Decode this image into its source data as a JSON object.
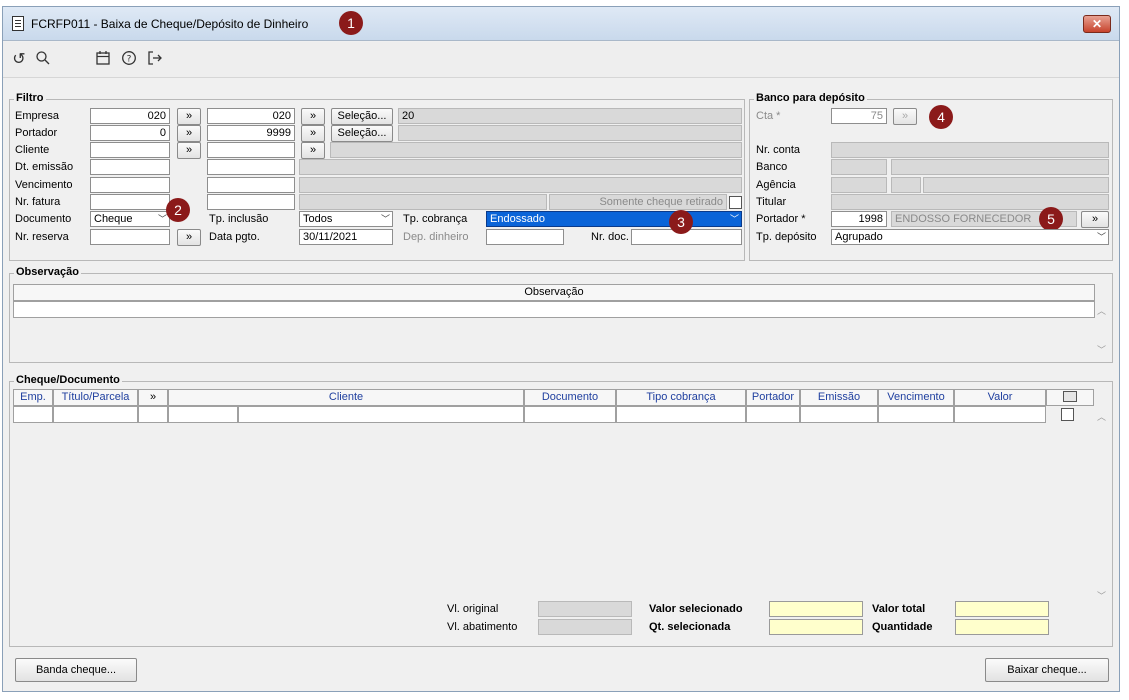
{
  "window": {
    "title": "FCRFP011 - Baixa de Cheque/Depósito de Dinheiro",
    "close_label": "✕"
  },
  "markers": [
    "1",
    "2",
    "3",
    "4",
    "5"
  ],
  "toolbar": {
    "icons": [
      "undo-icon",
      "search-icon",
      "calendar-icon",
      "help-icon",
      "exit-icon"
    ],
    "glyphs": {
      "undo": "↺",
      "search": "🔍",
      "calendar": "📅",
      "help": "?",
      "exit": "↦"
    }
  },
  "filtro": {
    "title": "Filtro",
    "labels": {
      "empresa": "Empresa",
      "portador": "Portador",
      "cliente": "Cliente",
      "dt_emissao": "Dt. emissão",
      "vencimento": "Vencimento",
      "nr_fatura": "Nr. fatura",
      "documento": "Documento",
      "nr_reserva": "Nr. reserva",
      "tp_inclusao": "Tp. inclusão",
      "data_pgto": "Data pgto.",
      "tp_cobranca": "Tp. cobrança",
      "dep_dinheiro": "Dep. dinheiro",
      "nr_doc": "Nr. doc.",
      "somente_cheque": "Somente cheque retirado"
    },
    "empresa_from": "020",
    "empresa_to": "020",
    "empresa_desc": "20",
    "portador_from": "0",
    "portador_to": "9999",
    "documento": "Cheque",
    "tp_inclusao": "Todos",
    "tp_cobranca": "Endossado",
    "data_pgto": "30/11/2021",
    "expand": "»",
    "selecao": "Seleção..."
  },
  "banco": {
    "title": "Banco para depósito",
    "labels": {
      "cta": "Cta *",
      "nr_conta": "Nr. conta",
      "banco": "Banco",
      "agencia": "Agência",
      "titular": "Titular",
      "portador": "Portador *",
      "tp_deposito": "Tp. depósito"
    },
    "cta": "75",
    "portador": "1998",
    "portador_desc": "ENDOSSO FORNECEDOR",
    "tp_deposito": "Agrupado"
  },
  "observacao": {
    "title": "Observação",
    "header": "Observação"
  },
  "cheque": {
    "title": "Cheque/Documento",
    "columns": [
      "Emp.",
      "Título/Parcela",
      "»",
      "Cliente",
      "Documento",
      "Tipo cobrança",
      "Portador",
      "Emissão",
      "Vencimento",
      "Valor"
    ]
  },
  "totals": {
    "vl_original": "Vl. original",
    "vl_abatimento": "Vl. abatimento",
    "valor_selecionado": "Valor selecionado",
    "qt_selecionada": "Qt. selecionada",
    "valor_total": "Valor total",
    "quantidade": "Quantidade"
  },
  "buttons": {
    "banda_cheque": "Banda cheque...",
    "baixar_cheque": "Baixar cheque..."
  }
}
